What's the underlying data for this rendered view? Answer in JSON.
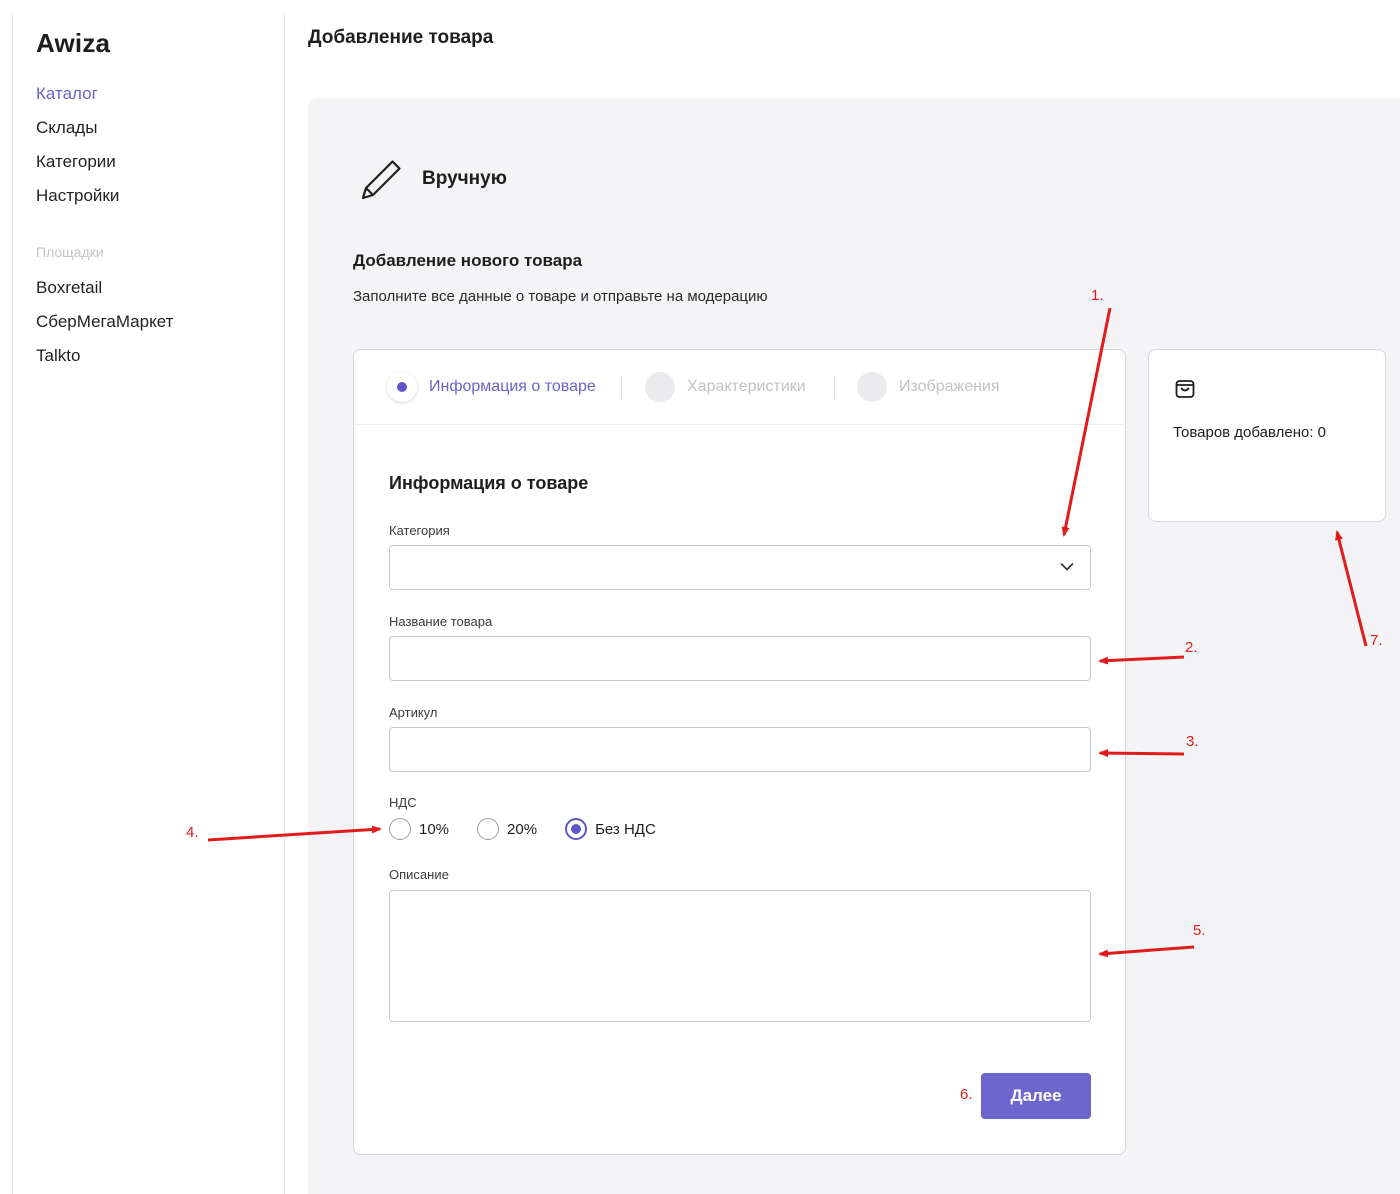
{
  "app": {
    "logo": "Awiza"
  },
  "sidebar": {
    "items": [
      {
        "label": "Каталог",
        "active": true
      },
      {
        "label": "Склады"
      },
      {
        "label": "Категории"
      },
      {
        "label": "Настройки"
      }
    ],
    "section_label": "Площадки",
    "marketplaces": [
      {
        "label": "Boxretail"
      },
      {
        "label": "СберМегаМаркет"
      },
      {
        "label": "Talkto"
      }
    ]
  },
  "header": {
    "title": "Добавление товара"
  },
  "mode": {
    "label": "Вручную",
    "icon": "pencil-icon"
  },
  "intro": {
    "title": "Добавление нового товара",
    "subtitle": "Заполните все данные о товаре и отправьте на модерацию"
  },
  "stepper": {
    "steps": [
      {
        "label": "Информация о товаре",
        "active": true
      },
      {
        "label": "Характеристики",
        "active": false
      },
      {
        "label": "Изображения",
        "active": false
      }
    ]
  },
  "form": {
    "title": "Информация о товаре",
    "category": {
      "label": "Категория",
      "value": ""
    },
    "name": {
      "label": "Название товара",
      "value": ""
    },
    "sku": {
      "label": "Артикул",
      "value": ""
    },
    "vat": {
      "label": "НДС",
      "options": [
        "10%",
        "20%",
        "Без НДС"
      ],
      "selected": "Без НДС"
    },
    "description": {
      "label": "Описание",
      "value": ""
    },
    "next_label": "Далее"
  },
  "summary": {
    "text": "Товаров добавлено: 0",
    "icon": "shopping-bag-icon"
  },
  "annotations": {
    "color": "#e11b1b",
    "labels": [
      "1.",
      "2.",
      "3.",
      "4.",
      "5.",
      "6.",
      "7."
    ]
  },
  "colors": {
    "accent": "#6c66cd",
    "panel_bg": "#f4f4f6"
  }
}
